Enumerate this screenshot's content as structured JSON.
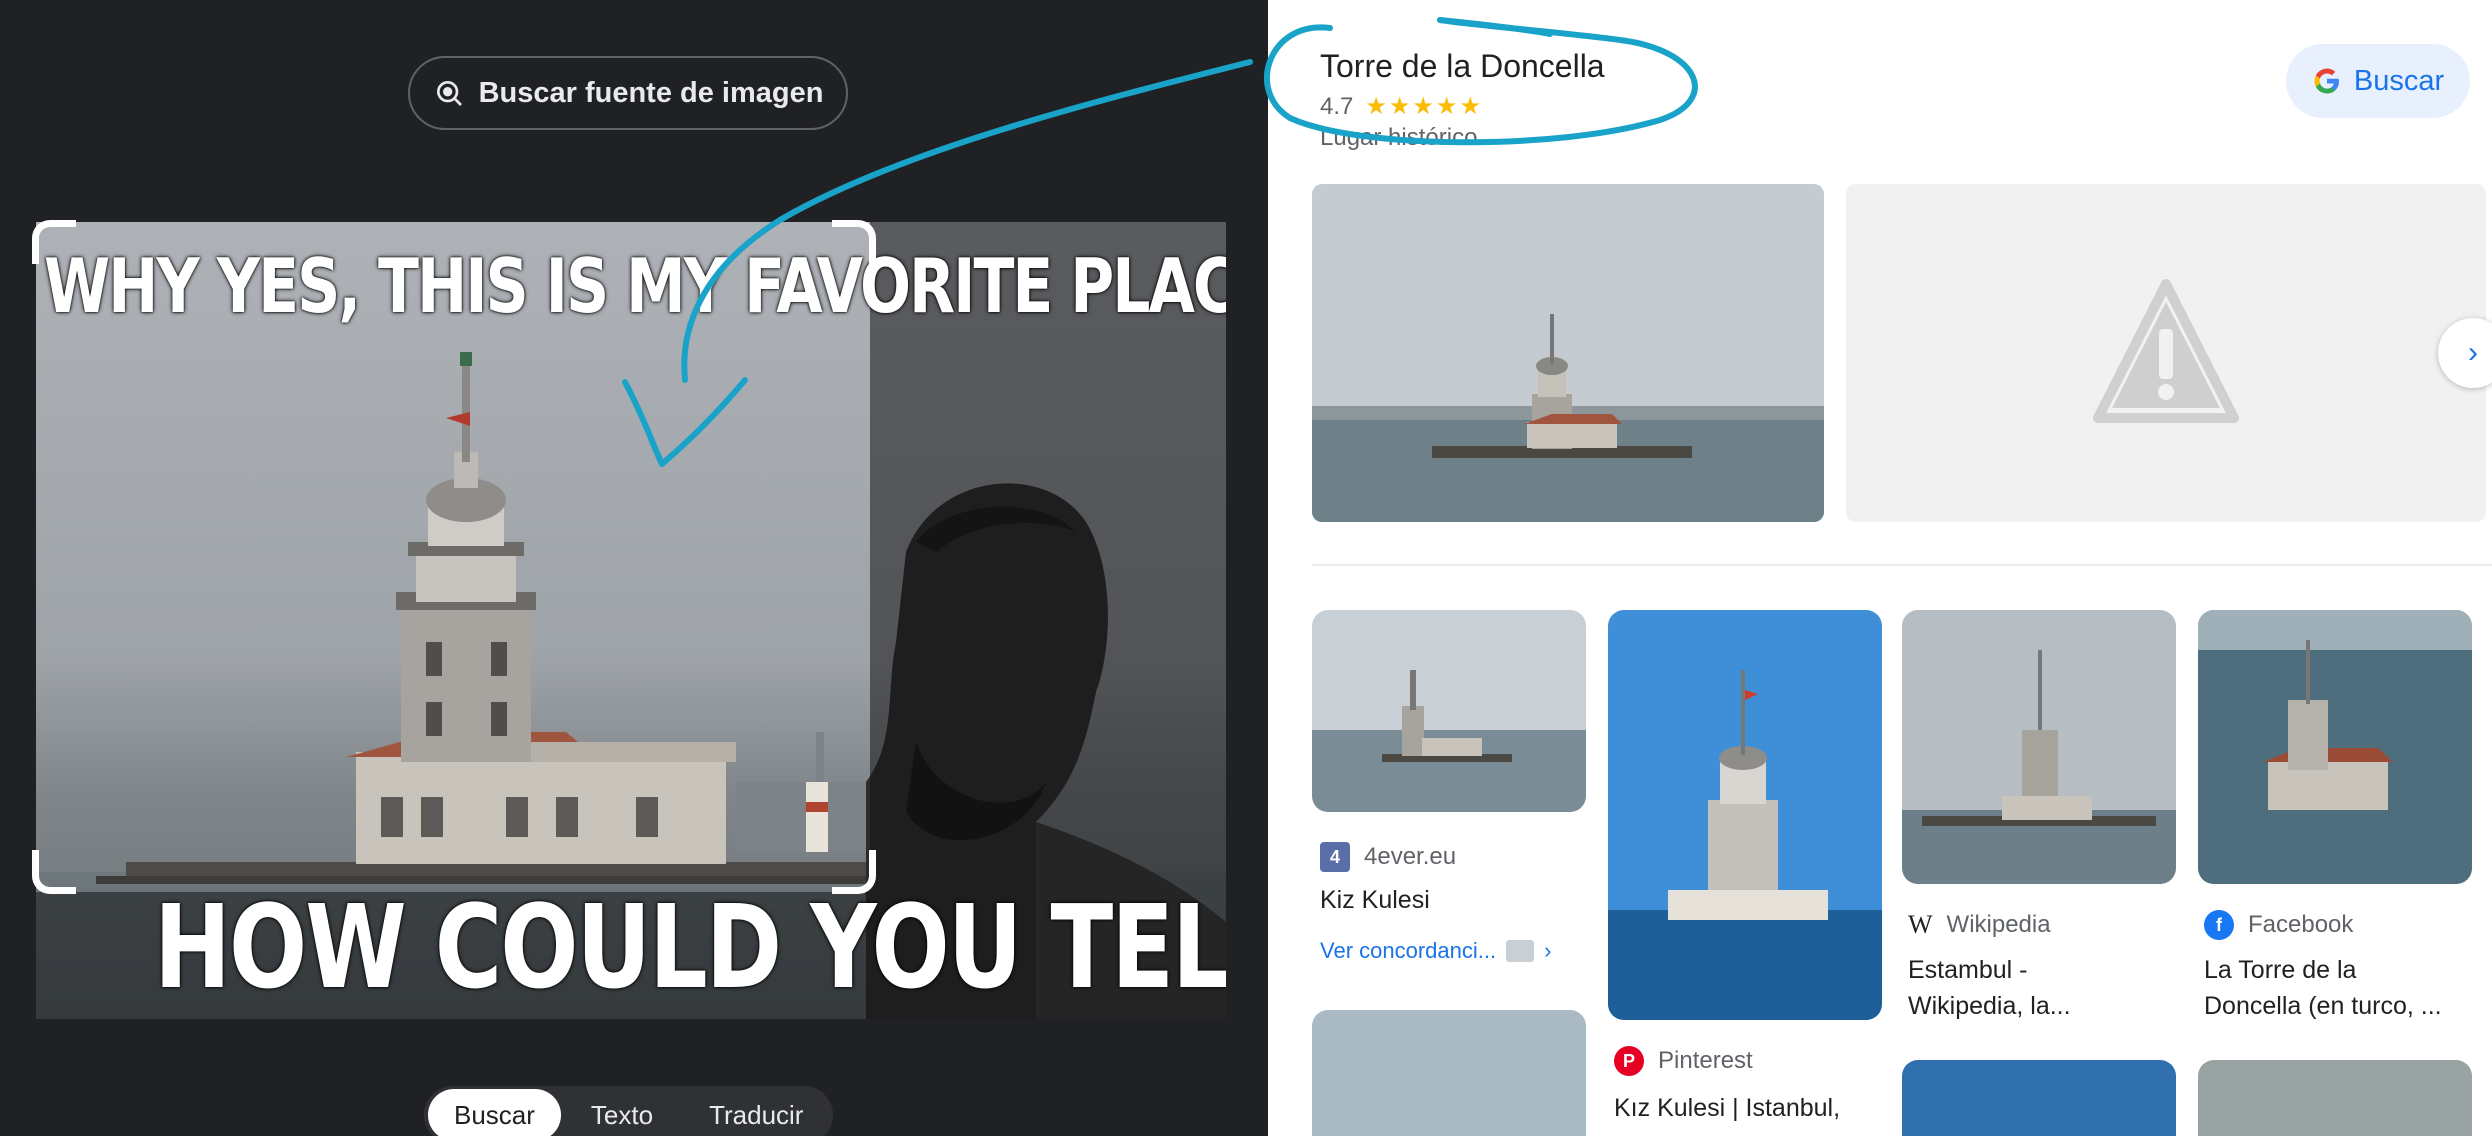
{
  "left_panel": {
    "source_button_label": "Buscar fuente de imagen",
    "meme": {
      "top_text": "WHY YES, THIS IS MY FAVORITE PLACE TO RELAX",
      "bottom_text": "HOW COULD YOU TELL?"
    },
    "tabs": [
      {
        "label": "Buscar",
        "active": true
      },
      {
        "label": "Texto",
        "active": false
      },
      {
        "label": "Traducir",
        "active": false
      }
    ]
  },
  "right_panel": {
    "place": {
      "title": "Torre de la Doncella",
      "rating": "4.7",
      "stars_text": "★★★★★",
      "category": "Lugar histórico"
    },
    "google_button_label": "Buscar",
    "results": [
      {
        "source": "4ever.eu",
        "title": "Kiz Kulesi",
        "link": "Ver concordanci..."
      },
      {
        "source": "Pinterest",
        "title": "Kız Kulesi | Istanbul,"
      },
      {
        "source": "Wikipedia",
        "title_line1": "Estambul -",
        "title_line2": "Wikipedia, la..."
      },
      {
        "source": "Facebook",
        "title_line1": "La Torre de la",
        "title_line2": "Doncella (en turco, ..."
      }
    ]
  },
  "colors": {
    "accent": "#1a73e8",
    "annotation": "#1aa3c9",
    "dark_bg": "#202124",
    "star": "#fbbc04"
  }
}
